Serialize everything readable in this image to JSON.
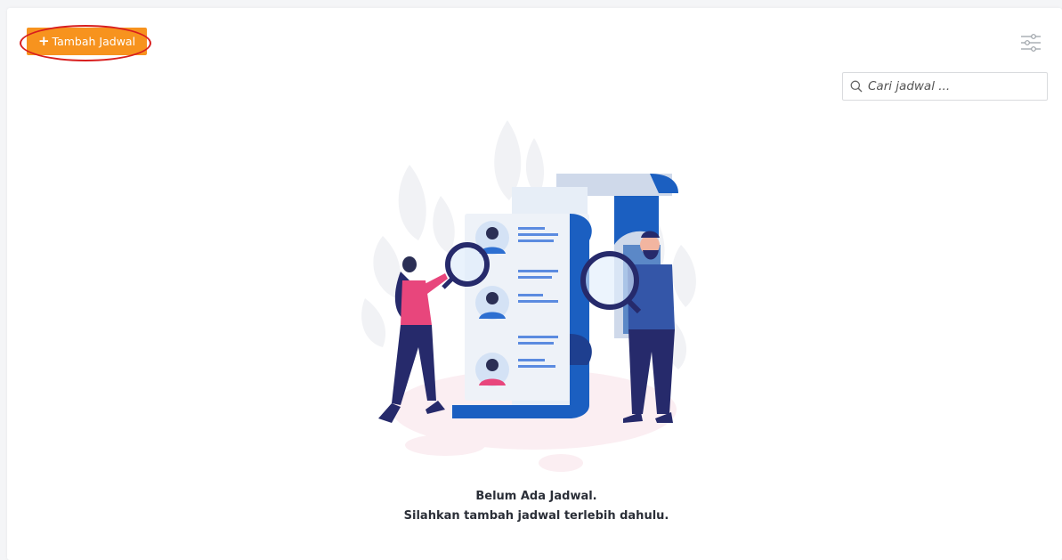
{
  "toolbar": {
    "add_label": "Tambah Jadwal",
    "add_icon": "plus-icon",
    "filter_icon": "sliders-icon"
  },
  "search": {
    "placeholder": "Cari jadwal ...",
    "icon": "search-icon"
  },
  "empty_state": {
    "title": "Belum Ada Jadwal.",
    "subtitle": "Silahkan tambah jadwal terlebih dahulu.",
    "illustration": "people-searching-schedule-illustration"
  },
  "colors": {
    "accent": "#f7931e",
    "annotation": "#d81e1e",
    "illustration_blue": "#1b5fc1",
    "illustration_navy": "#262a6b",
    "illustration_pink": "#e8467c",
    "text": "#2b2f38"
  }
}
